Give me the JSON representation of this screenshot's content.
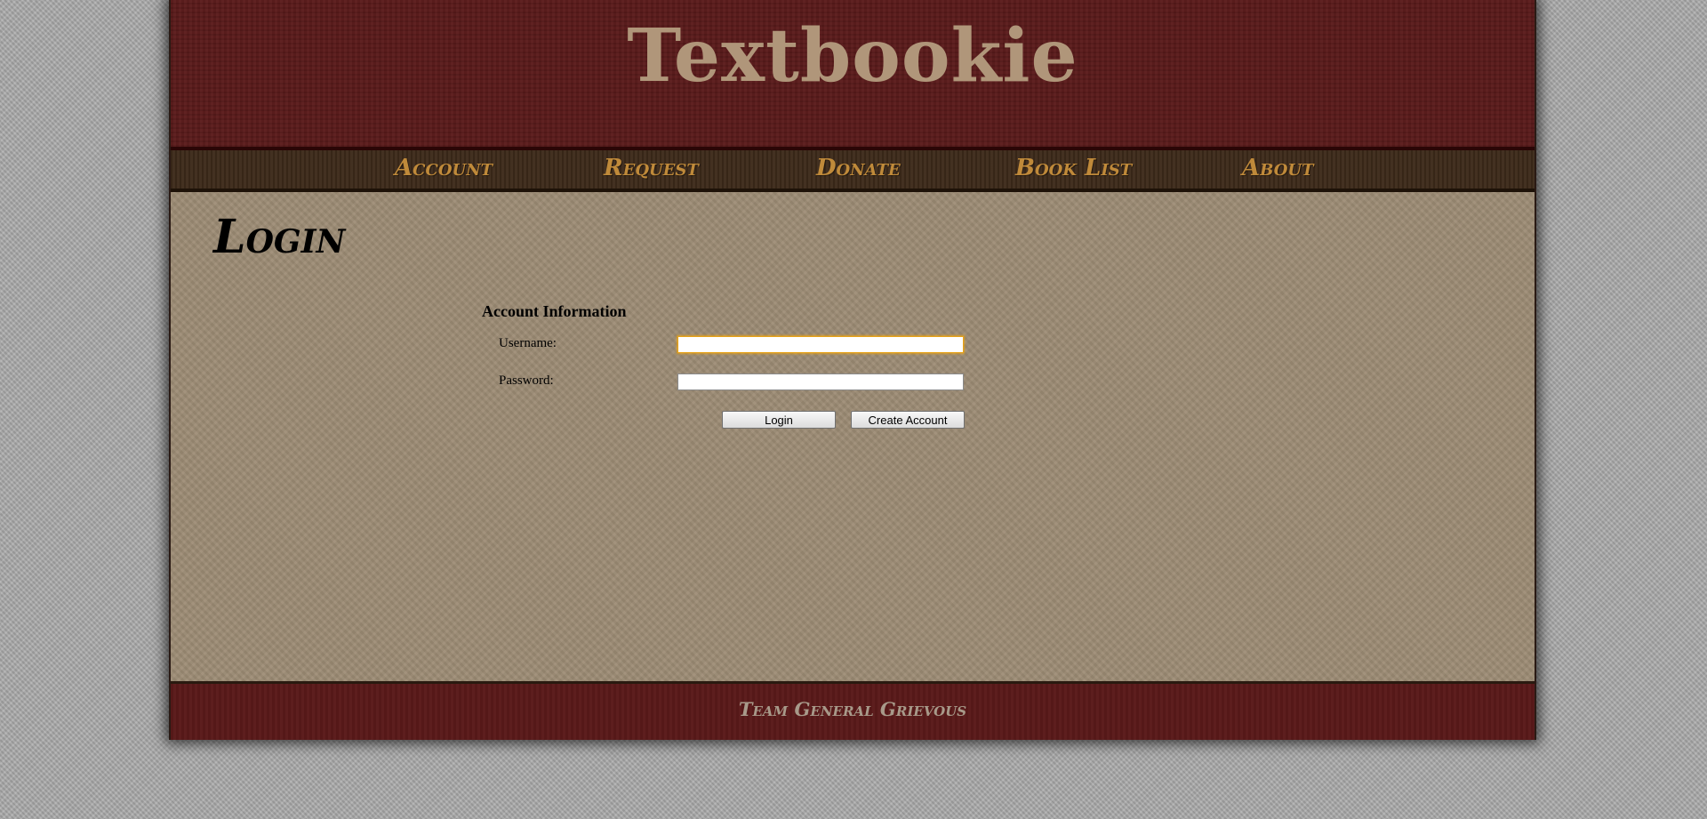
{
  "site": {
    "title": "Textbookie"
  },
  "nav": {
    "items": [
      {
        "label": "Account"
      },
      {
        "label": "Request"
      },
      {
        "label": "Donate"
      },
      {
        "label": "Book List"
      },
      {
        "label": "About"
      }
    ]
  },
  "main": {
    "page_title": "Login",
    "section_title": "Account Information",
    "form": {
      "username_label": "Username:",
      "username_value": "",
      "password_label": "Password:",
      "password_value": "",
      "login_button": "Login",
      "create_account_button": "Create Account"
    }
  },
  "footer": {
    "text": "Team General Grievous"
  },
  "colors": {
    "header_bg": "#5a1a1a",
    "title_color": "#b0967a",
    "nav_bg": "#3d2a1a",
    "nav_text": "#c08a3a",
    "content_bg": "#9c8b74",
    "focus_border": "#e8a317"
  }
}
